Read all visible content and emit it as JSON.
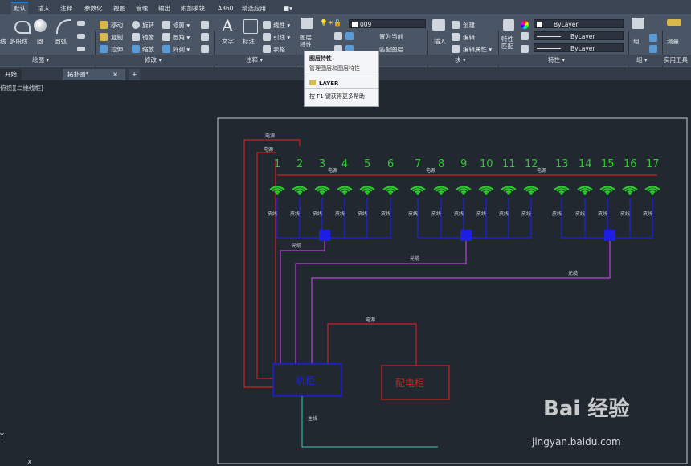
{
  "tabs": [
    "默认",
    "插入",
    "注释",
    "参数化",
    "视图",
    "管理",
    "输出",
    "附加模块",
    "A360",
    "精选应用"
  ],
  "ribbon": {
    "draw": {
      "line": "线",
      "polyline": "多段线",
      "circle": "圆",
      "arc": "圆弧",
      "title": "绘图 ▾"
    },
    "modify": {
      "move": "移动",
      "rotate": "旋转",
      "trim": "修剪 ▾",
      "copy": "复制",
      "mirror": "镜像",
      "fillet": "圆角 ▾",
      "stretch": "拉伸",
      "scale": "缩放",
      "array": "阵列 ▾",
      "title": "修改 ▾"
    },
    "annotation": {
      "text": "文字",
      "dim": "标注",
      "leader": "引线 ▾",
      "linear": "线性 ▾",
      "table": "表格",
      "title": "注释 ▾"
    },
    "layers": {
      "props_btn": "图层\n特性",
      "layer_combo": "009",
      "set_current": "置为当前",
      "match_layer": "匹配图层",
      "title": "图层"
    },
    "block": {
      "insert": "插入",
      "create": "创建",
      "edit": "编辑",
      "edit_attr": "编辑属性 ▾",
      "title": "块 ▾"
    },
    "properties": {
      "match": "特性\n匹配",
      "color": "ByLayer",
      "linetype": "ByLayer",
      "lineweight": "ByLayer",
      "title": "特性 ▾"
    },
    "groups": {
      "group": "组",
      "title": "组 ▾"
    },
    "utilities": {
      "measure": "测量",
      "title": "实用工具"
    }
  },
  "tooltip": {
    "title": "图层特性",
    "desc": "管理图层和图层特性",
    "command": "LAYER",
    "help": "按 F1 键获得更多帮助"
  },
  "doc_tabs": {
    "start": "开始",
    "drawing": "拓扑图*",
    "close": "×",
    "add": "+"
  },
  "viewport_label": "俯视][二维线框]",
  "drawing": {
    "numbers": [
      "1",
      "2",
      "3",
      "4",
      "5",
      "6",
      "7",
      "8",
      "9",
      "10",
      "11",
      "12",
      "13",
      "14",
      "15",
      "16",
      "17"
    ],
    "power": "电源",
    "cable": "皮线",
    "fiber": "光缆",
    "trunk": "主线",
    "cabinet": "机柜",
    "distribution": "配电柜"
  },
  "watermark": {
    "brand": "Bai  经验",
    "url": "jingyan.baidu.com"
  },
  "colors": {
    "red": "#d0201f",
    "blue": "#1e1ee6",
    "purple": "#c040e0",
    "green": "#2ec82e",
    "teal": "#30b0a0",
    "yellow": "#d8c820"
  }
}
